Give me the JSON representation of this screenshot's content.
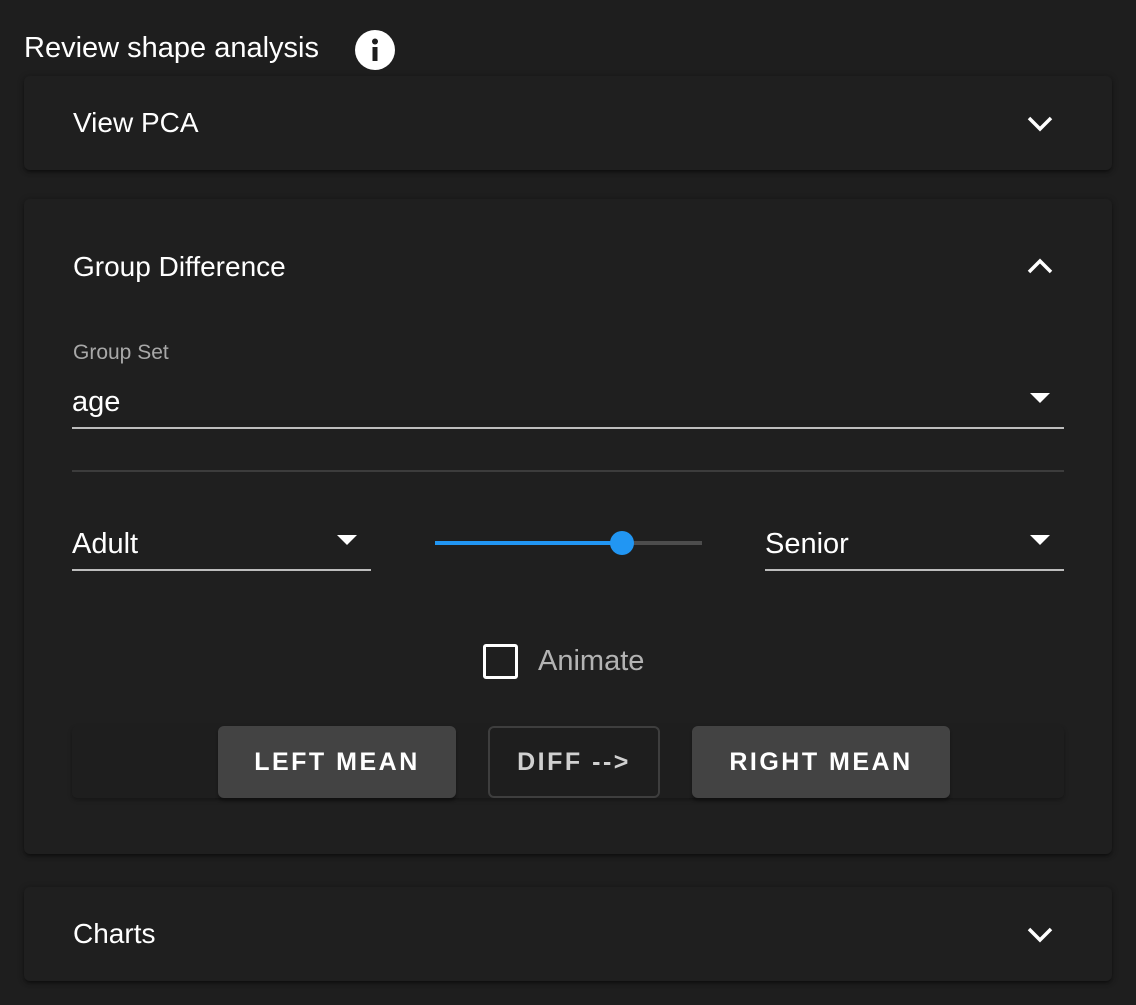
{
  "header": {
    "title": "Review shape analysis",
    "info_icon": "info-circle-icon"
  },
  "panels": {
    "pca": {
      "title": "View PCA",
      "expanded": false,
      "icon": "chevron-down-icon"
    },
    "group_difference": {
      "title": "Group Difference",
      "expanded": true,
      "icon": "chevron-up-icon",
      "group_set": {
        "label": "Group Set",
        "value": "age"
      },
      "left_group": {
        "value": "Adult"
      },
      "right_group": {
        "value": "Senior"
      },
      "slider": {
        "value": 0.7,
        "accent_color": "#2196f3"
      },
      "animate": {
        "label": "Animate",
        "checked": false
      },
      "buttons": {
        "left_mean": "LEFT MEAN",
        "diff": "DIFF -->",
        "right_mean": "RIGHT MEAN"
      }
    },
    "charts": {
      "title": "Charts",
      "expanded": false,
      "icon": "chevron-down-icon"
    }
  }
}
